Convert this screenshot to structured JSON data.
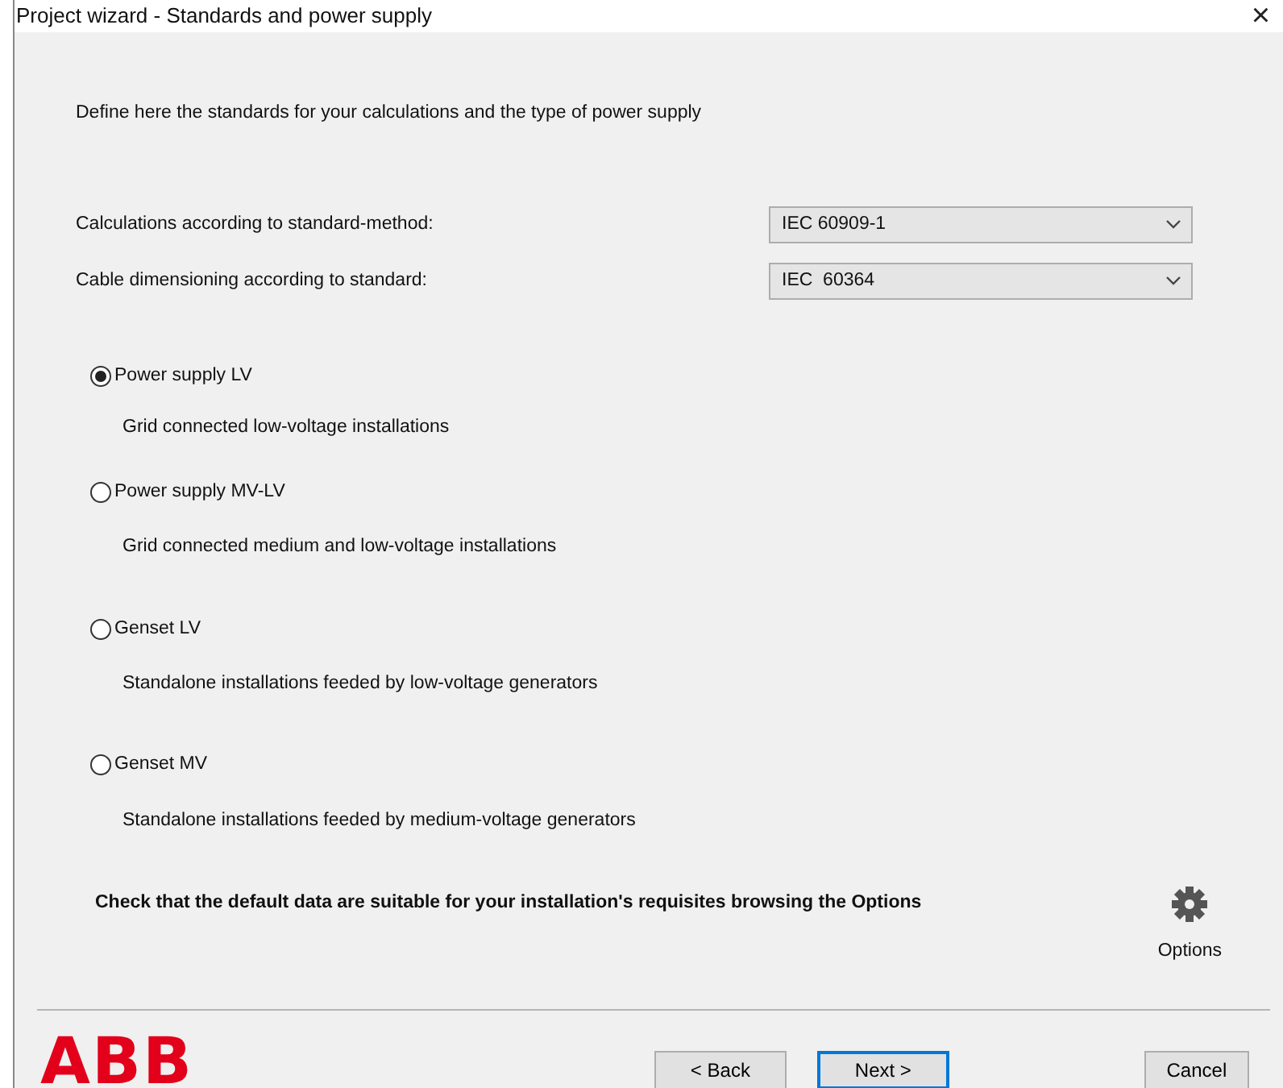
{
  "window": {
    "title": "Project wizard - Standards and power supply",
    "close": "×"
  },
  "intro": "Define here the standards for your calculations and the type of power supply",
  "fields": [
    {
      "label": "Calculations according to standard-method:",
      "value": "IEC 60909-1"
    },
    {
      "label": "Cable dimensioning according to standard:",
      "value": "IEC  60364"
    }
  ],
  "supplies": [
    {
      "label": "Power supply LV",
      "description": "Grid connected low-voltage installations",
      "selected": true
    },
    {
      "label": "Power supply MV-LV",
      "description": "Grid connected medium and low-voltage installations",
      "selected": false
    },
    {
      "label": "Genset LV",
      "description": "Standalone installations feeded by low-voltage generators",
      "selected": false
    },
    {
      "label": "Genset MV",
      "description": "Standalone installations feeded by medium-voltage generators",
      "selected": false
    }
  ],
  "note": "Check that the default data are suitable for your installation's requisites browsing the Options",
  "options_button": "Options",
  "logo": "ABB",
  "buttons": [
    {
      "label": "< Back",
      "kind": "normal"
    },
    {
      "label": "Next >",
      "kind": "default"
    },
    {
      "label": "Cancel",
      "kind": "cancel"
    }
  ]
}
